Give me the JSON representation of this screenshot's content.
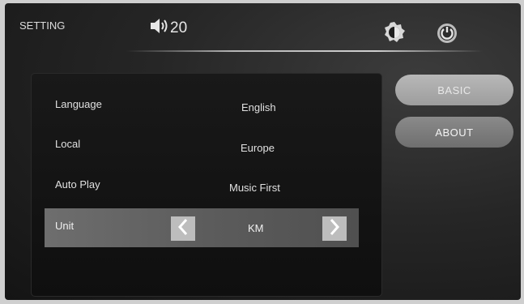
{
  "header": {
    "title": "SETTING",
    "volume": "20",
    "icons": [
      "speaker-icon",
      "brightness-icon",
      "power-icon"
    ]
  },
  "settings": {
    "rows": [
      {
        "label": "Language",
        "value": "English"
      },
      {
        "label": "Local",
        "value": "Europe"
      },
      {
        "label": "Auto Play",
        "value": "Music First"
      }
    ],
    "unit": {
      "label": "Unit",
      "value": "KM"
    }
  },
  "side_menu": {
    "basic_label": "BASIC",
    "about_label": "ABOUT",
    "active": "BASIC"
  }
}
